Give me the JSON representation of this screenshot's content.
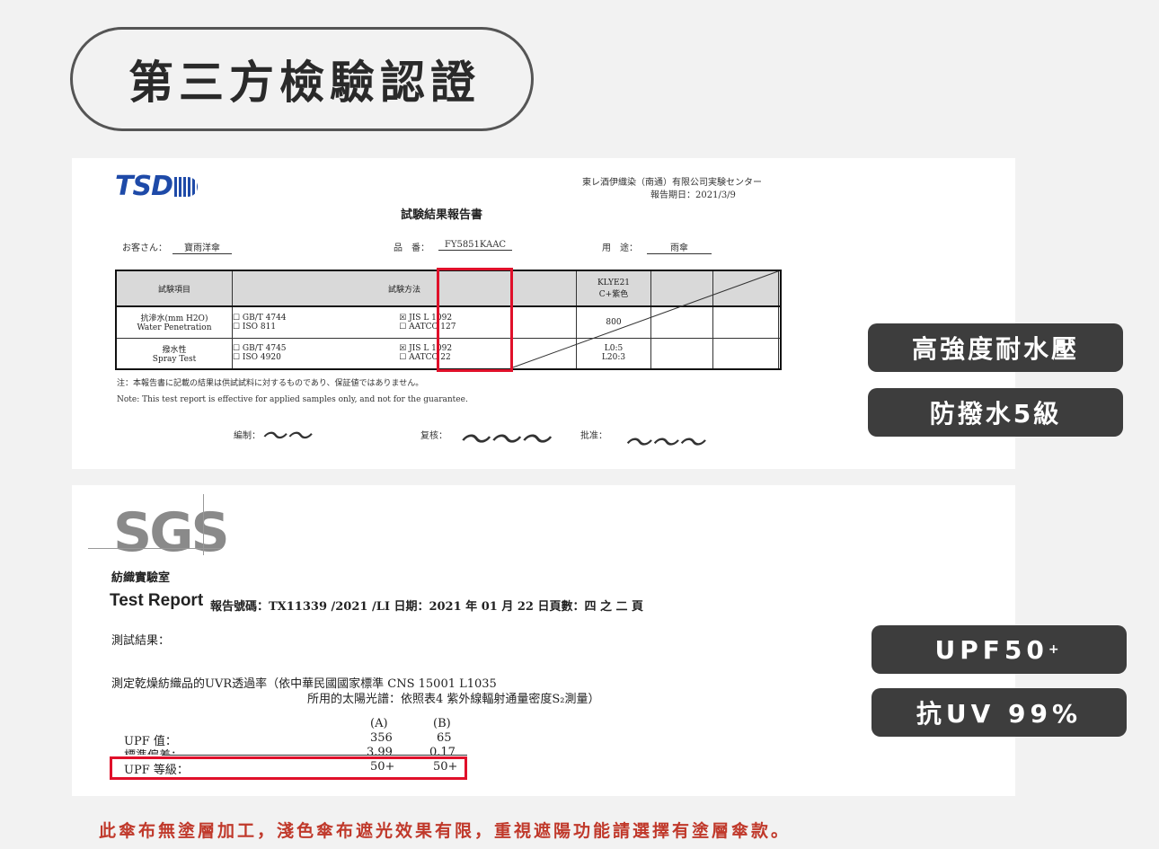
{
  "header": {
    "title": "第三方檢驗認證"
  },
  "tsd_report": {
    "logo": "TSD",
    "lab_name": "東レ酒伊織染（南通）有限公司実験センター",
    "report_date": "報告期日：2021/3/9",
    "report_title": "試験結果報告書",
    "customer_label": "お客さん：",
    "customer_value": "寶雨洋傘",
    "product_label": "品　番：",
    "product_value": "FY5851KAAC",
    "usage_label": "用　途：",
    "usage_value": "雨傘",
    "table": {
      "col_item": "試験項目",
      "col_method": "試験方法",
      "col_sample": "KLYE21\nC+紫色",
      "rows": [
        {
          "item": "抗滲水(mm H2O)\nWater Penetration",
          "method_a": "☐ GB/T 4744\n☐ ISO 811",
          "method_b": "☒ JIS L 1092\n☐ AATCC 127",
          "value": "800"
        },
        {
          "item": "撥水性\nSpray Test",
          "method_a": "☐ GB/T 4745\n☐ ISO 4920",
          "method_b": "☒ JIS L 1092\n☐ AATCC 22",
          "value": "L0:5\nL20:3"
        }
      ]
    },
    "note_jp": "注：本報告書に記載の結果は供試試料に対するものであり、保証値ではありません。",
    "note_en": "Note: This test report is effective for applied samples only, and not for the guarantee.",
    "sign_editor_label": "編制：",
    "sign_review_label": "复核：",
    "sign_approve_label": "批准："
  },
  "sgs_report": {
    "logo": "SGS",
    "lab_name": "紡織實驗室",
    "report_label": "Test Report",
    "report_info": "報告號碼：TX11339 /2021 /LI 日期：2021 年 01 月 22 日頁數：四 之 二 頁",
    "result_label": "測試結果：",
    "method_line1": "測定乾燥紡織品的UVR透過率（依中華民國國家標準 CNS 15001 L1035",
    "method_line2": "所用的太陽光譜：依照表4 紫外線輻射通量密度S₂測量）",
    "col_a": "(A)",
    "col_b": "(B)",
    "rows": [
      {
        "label": "UPF 值：",
        "a": "356",
        "b": "65"
      },
      {
        "label": "標準偏差：",
        "a": "3.99",
        "b": "0.17"
      },
      {
        "label": "UPF 等級：",
        "a": "50+",
        "b": "50+"
      }
    ]
  },
  "tags": {
    "waterproof": "高強度耐水壓",
    "repellent": "防撥水5級",
    "upf": "UPF50",
    "upf_sup": "+",
    "uv": "抗UV 99%"
  },
  "footnote": "此傘布無塗層加工，淺色傘布遮光效果有限，重視遮陽功能請選擇有塗層傘款。"
}
